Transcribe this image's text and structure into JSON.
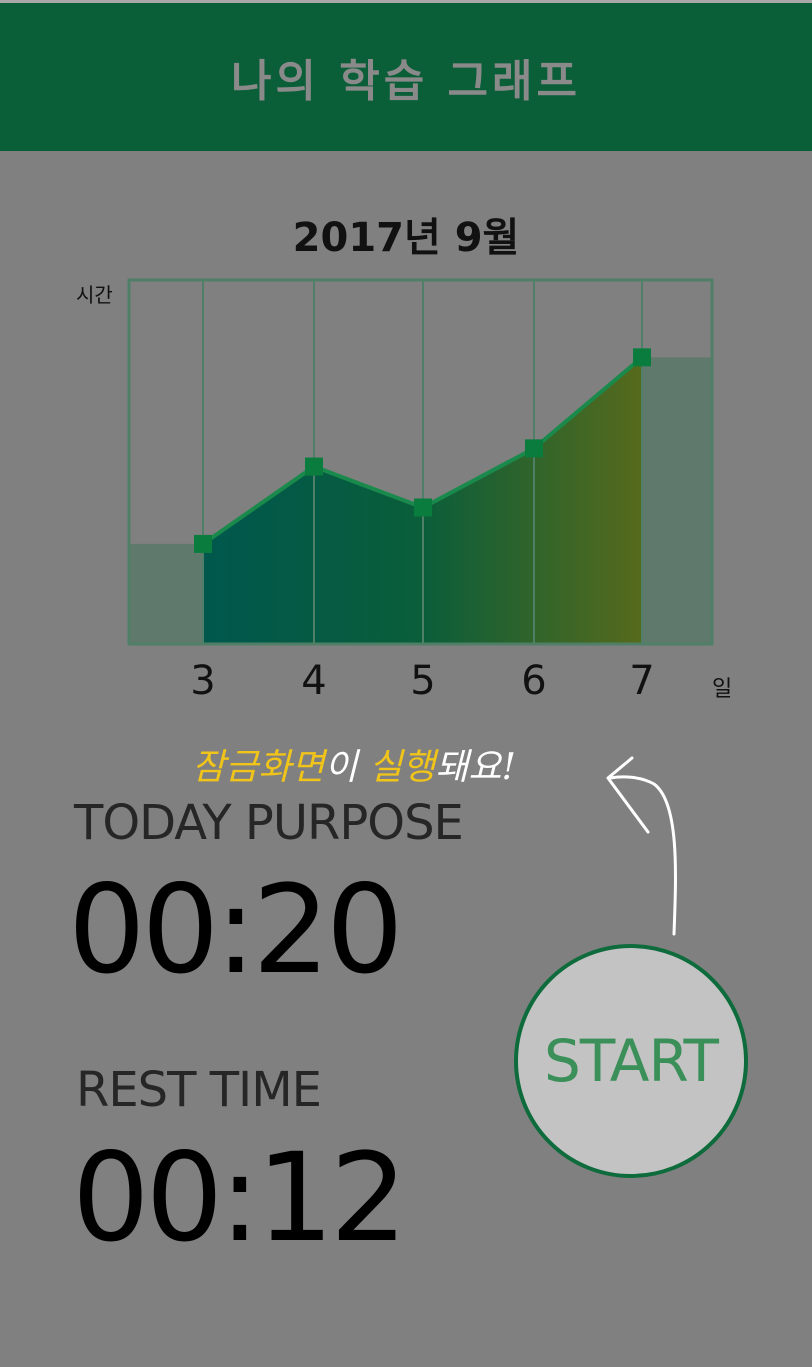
{
  "header": {
    "title": "나의 학습 그래프"
  },
  "chart_data": {
    "type": "area",
    "title": "2017년 9월",
    "ylabel": "시간",
    "xlabel": "일",
    "categories": [
      "3",
      "4",
      "5",
      "6",
      "7"
    ],
    "values": [
      2.2,
      3.9,
      3.0,
      4.3,
      6.3
    ],
    "ylim": [
      0,
      8
    ],
    "grid": true,
    "marker": "square",
    "colors": {
      "line": "#1a8a4c",
      "marker": "#0a7d3e",
      "frame": "#4f7f66",
      "side_fill": "#5f7a6c"
    }
  },
  "hint": {
    "part1": "잠금화면",
    "part2": "이 ",
    "part3": "실행",
    "part4": "돼요!"
  },
  "purpose": {
    "label": "TODAY PURPOSE",
    "time": "00:20"
  },
  "rest": {
    "label": "REST TIME",
    "time": "00:12"
  },
  "start_button": {
    "label": "START"
  }
}
